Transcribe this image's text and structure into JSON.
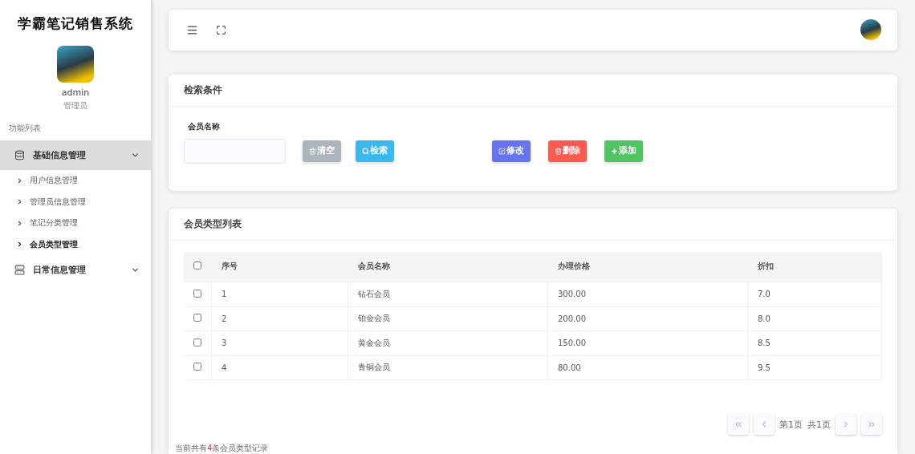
{
  "sidebar": {
    "title": "学霸笔记销售系统",
    "user": {
      "name": "admin",
      "role": "管理员"
    },
    "section_label": "功能列表",
    "groups": [
      {
        "label": "基础信息管理",
        "expanded": true,
        "children": [
          {
            "label": "用户信息管理",
            "selected": false
          },
          {
            "label": "管理员信息管理",
            "selected": false
          },
          {
            "label": "笔记分类管理",
            "selected": false
          },
          {
            "label": "会员类型管理",
            "selected": true
          }
        ]
      },
      {
        "label": "日常信息管理",
        "expanded": false
      }
    ]
  },
  "search": {
    "title": "检索条件",
    "field_label": "会员名称",
    "buttons": [
      {
        "kind": "clear",
        "label": "清空"
      },
      {
        "kind": "search",
        "label": "检索"
      }
    ],
    "actions": [
      {
        "kind": "edit",
        "label": "修改"
      },
      {
        "kind": "delete",
        "label": "删除"
      },
      {
        "kind": "add",
        "label": "添加"
      }
    ]
  },
  "table": {
    "title": "会员类型列表",
    "all_checked": false,
    "columns": [
      "序号",
      "会员名称",
      "办理价格",
      "折扣"
    ],
    "rows": [
      {
        "checked": false,
        "cells": [
          "1",
          "钻石会员",
          "300.00",
          "7.0"
        ]
      },
      {
        "checked": false,
        "cells": [
          "2",
          "铂金会员",
          "200.00",
          "8.0"
        ]
      },
      {
        "checked": false,
        "cells": [
          "3",
          "黄金会员",
          "150.00",
          "8.5"
        ]
      },
      {
        "checked": false,
        "cells": [
          "4",
          "青铜会员",
          "80.00",
          "9.5"
        ]
      }
    ],
    "pagination": {
      "current": "第1页",
      "total": "共1页"
    },
    "summary": {
      "prefix": "当前共有",
      "count": "4",
      "suffix": "条会员类型记录"
    }
  }
}
